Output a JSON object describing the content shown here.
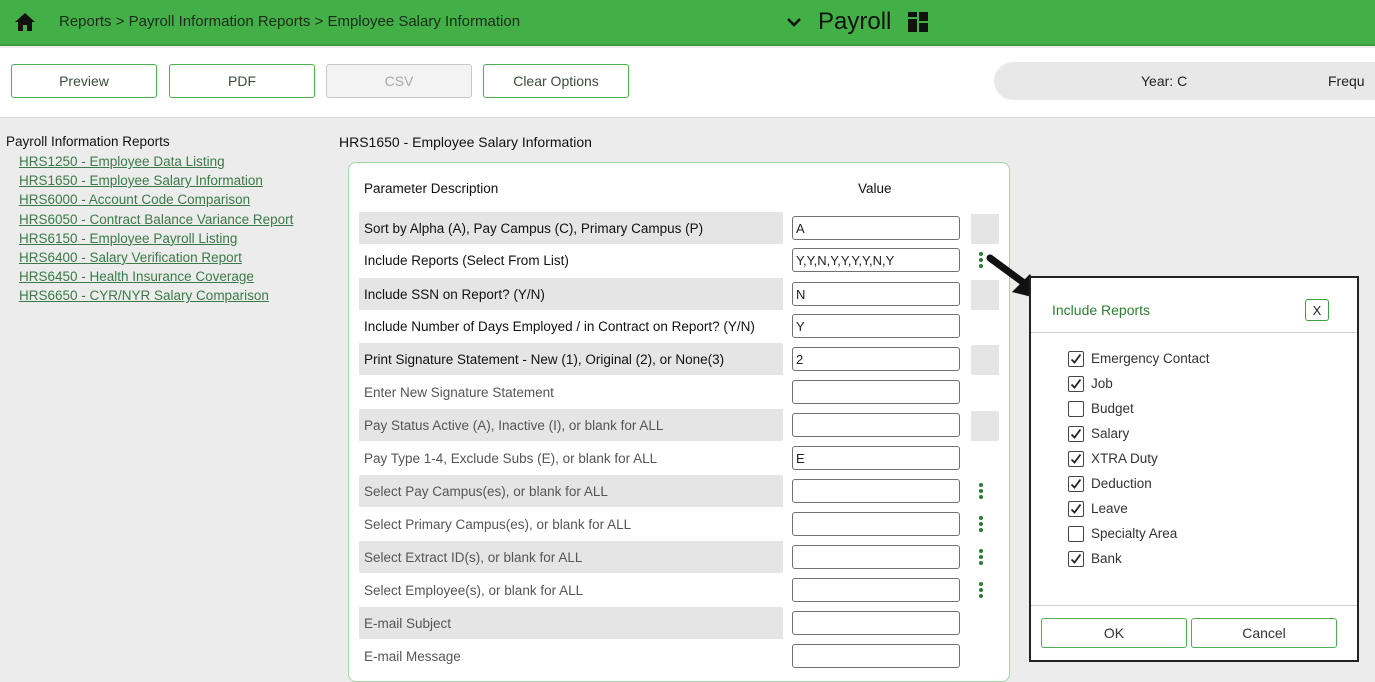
{
  "header": {
    "breadcrumb": "Reports > Payroll Information Reports > Employee Salary Information",
    "app_title": "Payroll"
  },
  "toolbar": {
    "preview_label": "Preview",
    "pdf_label": "PDF",
    "csv_label": "CSV",
    "clear_label": "Clear Options",
    "year_text": "Year: C",
    "frequency_text": "Frequ"
  },
  "nav": {
    "title": "Payroll Information Reports",
    "links": [
      "HRS1250 - Employee Data Listing",
      "HRS1650 - Employee Salary Information",
      "HRS6000 - Account Code Comparison",
      "HRS6050 - Contract Balance Variance Report",
      "HRS6150 - Employee Payroll Listing",
      "HRS6400 - Salary Verification Report",
      "HRS6450 - Health Insurance Coverage",
      "HRS6650 - CYR/NYR Salary Comparison"
    ]
  },
  "main": {
    "title": "HRS1650 - Employee Salary Information",
    "col_param": "Parameter Description",
    "col_value": "Value",
    "params": [
      {
        "label": "Sort by Alpha (A), Pay Campus (C), Primary Campus (P)",
        "value": "A"
      },
      {
        "label": "Include Reports (Select From List)",
        "value": "Y,Y,N,Y,Y,Y,Y,N,Y"
      },
      {
        "label": "Include SSN on Report? (Y/N)",
        "value": "N"
      },
      {
        "label": "Include Number of Days Employed / in Contract on Report? (Y/N)",
        "value": "Y"
      },
      {
        "label": "Print Signature Statement - New (1), Original (2), or None(3)",
        "value": "2"
      },
      {
        "label": "Enter New Signature Statement",
        "value": ""
      },
      {
        "label": "Pay Status Active (A), Inactive (I), or blank for ALL",
        "value": ""
      },
      {
        "label": "Pay Type 1-4, Exclude Subs (E), or blank for ALL",
        "value": "E"
      },
      {
        "label": "Select Pay Campus(es), or blank for ALL",
        "value": ""
      },
      {
        "label": "Select Primary Campus(es), or blank for ALL",
        "value": ""
      },
      {
        "label": "Select Extract ID(s), or blank for ALL",
        "value": ""
      },
      {
        "label": "Select Employee(s), or blank for ALL",
        "value": ""
      },
      {
        "label": "E-mail Subject",
        "value": ""
      },
      {
        "label": "E-mail Message",
        "value": ""
      }
    ]
  },
  "popup": {
    "title": "Include Reports",
    "close_label": "X",
    "ok_label": "OK",
    "cancel_label": "Cancel",
    "options": [
      {
        "label": "Emergency Contact",
        "checked": true
      },
      {
        "label": "Job",
        "checked": true
      },
      {
        "label": "Budget",
        "checked": false
      },
      {
        "label": "Salary",
        "checked": true
      },
      {
        "label": "XTRA Duty",
        "checked": true
      },
      {
        "label": "Deduction",
        "checked": true
      },
      {
        "label": "Leave",
        "checked": true
      },
      {
        "label": "Specialty Area",
        "checked": false
      },
      {
        "label": "Bank",
        "checked": true
      }
    ]
  },
  "icons": {
    "home": "home-icon",
    "chevron": "chevron-down-icon",
    "grid": "grid-icon",
    "more": "more-vertical-icon",
    "arrow": "arrow-annotation-icon"
  },
  "colors": {
    "header_green": "#43b047",
    "button_border": "#4caf50",
    "link_green": "#3b7a47"
  }
}
